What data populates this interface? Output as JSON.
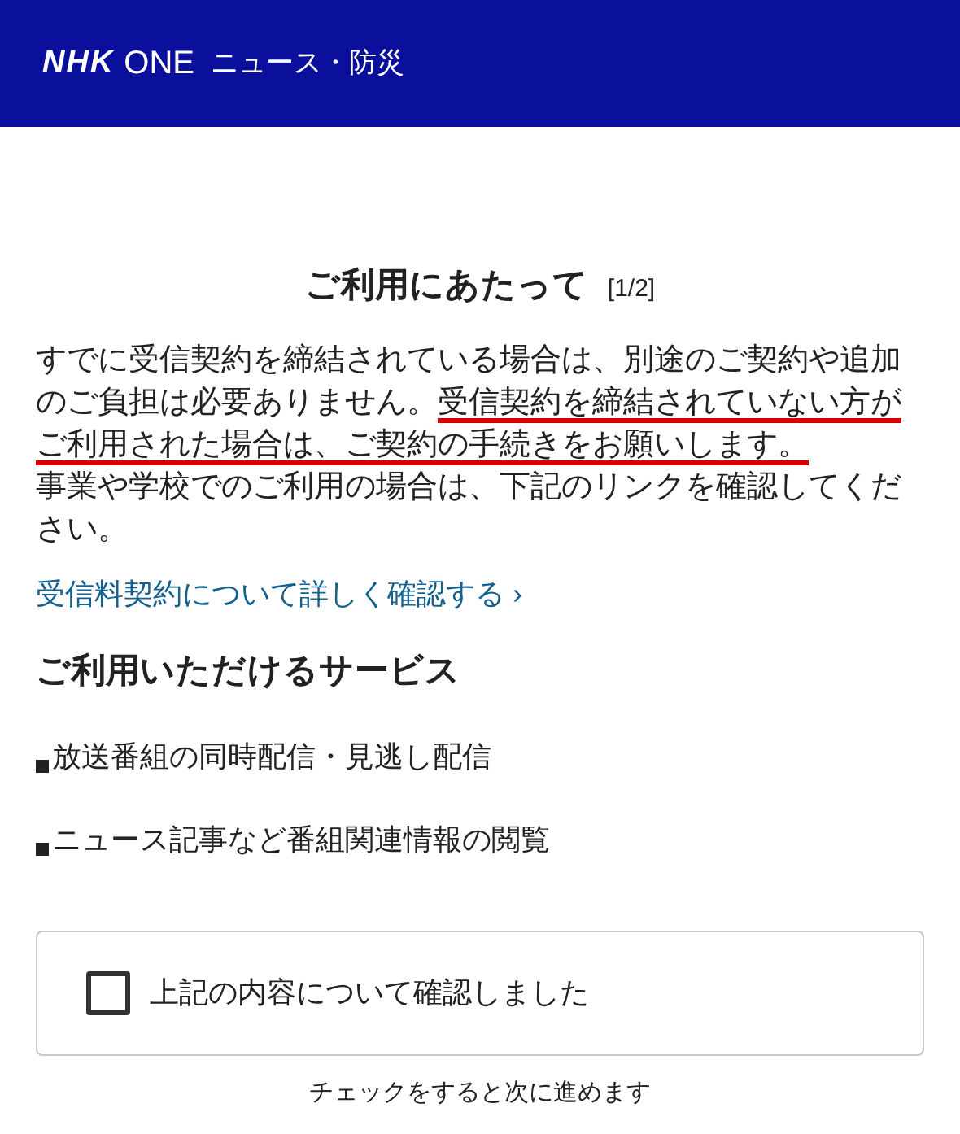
{
  "header": {
    "logo": "NHK",
    "brand": "ONE",
    "section": "ニュース・防災"
  },
  "title": {
    "text": "ご利用にあたって",
    "page": "[1/2]"
  },
  "notice": [
    {
      "text": "すでに受信契約を締結されている場合は、別途のご契約や追加のご負担は必要ありません。",
      "underlined": false
    },
    {
      "text": "受信契約を締結されていない方がご利用された場合は、ご契約の手続きをお願いします。",
      "underlined": true
    }
  ],
  "notice_2": "事業や学校でのご利用の場合は、下記のリンクを確認してください。",
  "link": {
    "text": "受信料契約について詳しく確認する",
    "arrow": "›"
  },
  "services": {
    "heading": "ご利用いただけるサービス",
    "items": [
      "放送番組の同時配信・見逃し配信",
      "ニュース記事など番組関連情報の閲覧"
    ]
  },
  "confirm": {
    "label": "上記の内容について確認しました",
    "checked": false
  },
  "hint": "チェックをすると次に進めます"
}
